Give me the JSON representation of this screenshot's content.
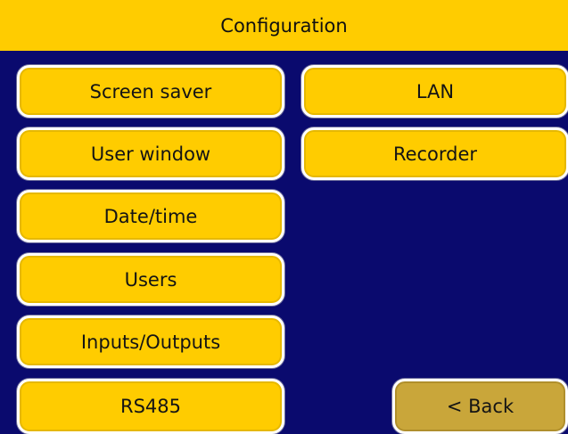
{
  "header": {
    "title": "Configuration"
  },
  "menu": {
    "left": [
      "Screen saver",
      "User window",
      "Date/time",
      "Users",
      "Inputs/Outputs",
      "RS485"
    ],
    "right": [
      "LAN",
      "Recorder"
    ],
    "back_label": "< Back"
  },
  "colors": {
    "background": "#0a0a6e",
    "accent": "#ffcc00",
    "back_button": "#c9a63a"
  }
}
